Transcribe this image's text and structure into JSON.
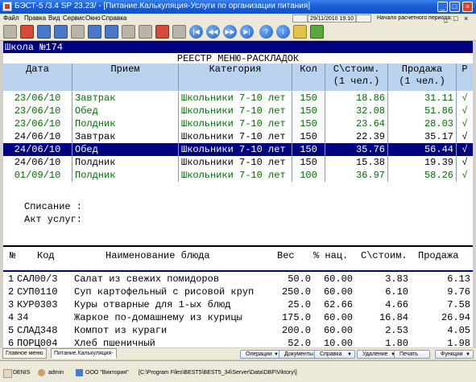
{
  "window": {
    "title": "БЭСТ-5 /3.4 SP 23.23/ - [Питание.Калькуляция-Услуги по организации питания]",
    "controls": [
      "_",
      "□",
      "×"
    ],
    "mdi_controls": [
      "_",
      "□",
      "×"
    ]
  },
  "menu": {
    "items": [
      "Файл",
      "Правка",
      "Вид",
      "Сервис",
      "Окно",
      "Справка"
    ],
    "datetime": "[ 29/11/2010 19:10 ]",
    "period": "Начало расчетного периода: 01/03/2009"
  },
  "toolbar": {
    "icons": [
      "save-icon",
      "calendar-icon",
      "print-icon",
      "print-preview-icon",
      "copy-icon",
      "recalc-icon",
      "refresh-icon",
      "filter-icon",
      "filter-off-icon",
      "cut-icon",
      "calculator-icon",
      "first-icon",
      "prev-icon",
      "next-icon",
      "last-icon",
      "help-icon",
      "info-icon",
      "chart-icon",
      "mail-icon"
    ],
    "nav_glyphs": {
      "first": "|◀",
      "prev": "◀◀",
      "next": "▶▶",
      "last": "▶|",
      "help": "?",
      "info": "i"
    }
  },
  "doc": {
    "school": "Школа №174",
    "registry_title": "РЕЕСТР МЕНЮ-РАСКЛАДОК",
    "columns": [
      {
        "key": "date",
        "label": "Дата"
      },
      {
        "key": "meal",
        "label": "Прием"
      },
      {
        "key": "category",
        "label": "Категория"
      },
      {
        "key": "qty",
        "label": "Кол"
      },
      {
        "key": "cost",
        "label": "С\\стоим.\n(1 чел.)"
      },
      {
        "key": "sale",
        "label": "Продажа\n(1 чел.)"
      },
      {
        "key": "p",
        "label": "Р"
      }
    ],
    "rows": [
      {
        "date": "23/06/10",
        "meal": "Завтрак",
        "category": "Школьники 7-10 лет",
        "qty": "150",
        "cost": "18.86",
        "sale": "31.11",
        "p": "√",
        "style": "green"
      },
      {
        "date": "23/06/10",
        "meal": "Обед",
        "category": "Школьники 7-10 лет",
        "qty": "150",
        "cost": "32.08",
        "sale": "51.86",
        "p": "√",
        "style": "green"
      },
      {
        "date": "23/06/10",
        "meal": "Полдник",
        "category": "Школьники 7-10 лет",
        "qty": "150",
        "cost": "23.64",
        "sale": "28.03",
        "p": "√",
        "style": "green"
      },
      {
        "date": "24/06/10",
        "meal": "Завтрак",
        "category": "Школьники 7-10 лет",
        "qty": "150",
        "cost": "22.39",
        "sale": "35.17",
        "p": "√",
        "style": "black"
      },
      {
        "date": "24/06/10",
        "meal": "Обед",
        "category": "Школьники 7-10 лет",
        "qty": "150",
        "cost": "35.76",
        "sale": "56.44",
        "p": "√",
        "style": "selected"
      },
      {
        "date": "24/06/10",
        "meal": "Полдник",
        "category": "Школьники 7-10 лет",
        "qty": "150",
        "cost": "15.38",
        "sale": "19.39",
        "p": "√",
        "style": "black"
      },
      {
        "date": "01/09/10",
        "meal": "Полдник",
        "category": "Школьники 7-10 лет",
        "qty": "100",
        "cost": "36.97",
        "sale": "58.26",
        "p": "√",
        "style": "green"
      }
    ],
    "writeoff_label": "Списание :",
    "act_label": "Акт услуг:"
  },
  "dishes": {
    "header": {
      "no": "№",
      "code": "Код",
      "name": "Наименование блюда",
      "weight": "Вес",
      "markup": "% нац.",
      "cost": "С\\стоим.",
      "sale": "Продажа"
    },
    "rows": [
      {
        "no": "1",
        "code": "САЛ00/3",
        "name": "Салат из свежих помидоров",
        "weight": "50.0",
        "markup": "60.00",
        "cost": "3.83",
        "sale": "6.13"
      },
      {
        "no": "2",
        "code": "СУП0110",
        "name": "Суп картофельный с рисовой круп",
        "weight": "250.0",
        "markup": "60.00",
        "cost": "6.10",
        "sale": "9.76"
      },
      {
        "no": "3",
        "code": "КУР0303",
        "name": "Куры отварные для 1-ых блюд",
        "weight": "25.0",
        "markup": "62.66",
        "cost": "4.66",
        "sale": "7.58"
      },
      {
        "no": "4",
        "code": "34",
        "name": "Жаркое по-домашнему из курицы",
        "weight": "175.0",
        "markup": "60.00",
        "cost": "16.84",
        "sale": "26.94"
      },
      {
        "no": "5",
        "code": "СЛАД348",
        "name": "Компот из кураги",
        "weight": "200.0",
        "markup": "60.00",
        "cost": "2.53",
        "sale": "4.05"
      },
      {
        "no": "6",
        "code": "ПОРЦ004",
        "name": "Хлеб пшеничный",
        "weight": "52.0",
        "markup": "10.00",
        "cost": "1.80",
        "sale": "1.98"
      }
    ]
  },
  "tabs": [
    {
      "label": "Главное меню"
    },
    {
      "label": "Питание.Калькуляция-"
    }
  ],
  "actions": [
    {
      "label": "Операции",
      "arrow": "▼"
    },
    {
      "label": "Документы",
      "arrow": "▼"
    },
    {
      "label": "Справка",
      "arrow": "▼"
    },
    {
      "label": "Удаление",
      "arrow": "▼"
    },
    {
      "label": "Печать",
      "arrow": ""
    },
    {
      "label": "Функции",
      "arrow": "▼"
    }
  ],
  "statusbar": {
    "user_code": "DENIS",
    "user": "admin",
    "org": "ООО \"Виктория\"",
    "path": "[C:\\Program Files\\BEST5\\BEST5_34\\Server\\Data\\DBF\\Viktory\\]"
  }
}
